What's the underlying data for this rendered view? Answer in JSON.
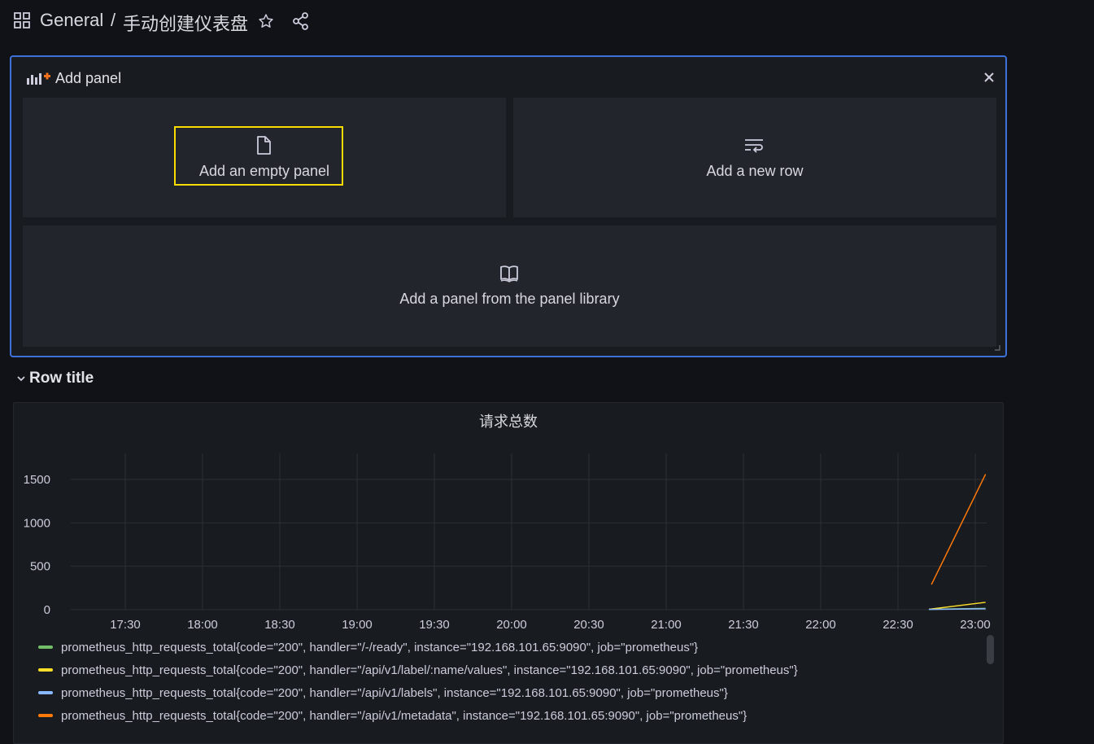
{
  "header": {
    "folder": "General",
    "separator": "/",
    "dashboard_title": "手动创建仪表盘",
    "icons": [
      "apps-grid-icon",
      "star-icon",
      "share-icon"
    ]
  },
  "add_panel": {
    "title": "Add panel",
    "options": [
      {
        "label": "Add an empty panel",
        "icon": "file-icon",
        "highlighted": true
      },
      {
        "label": "Add a new row",
        "icon": "row-wrap-icon"
      },
      {
        "label": "Add a panel from the panel library",
        "icon": "book-icon"
      }
    ],
    "accent": "#3d71d9",
    "highlight_color": "#fadc00"
  },
  "row": {
    "title": "Row title"
  },
  "graph": {
    "title": "请求总数"
  },
  "chart_data": {
    "type": "line",
    "title": "请求总数",
    "xlabel": "",
    "ylabel": "",
    "x_ticks": [
      "17:30",
      "18:00",
      "18:30",
      "19:00",
      "19:30",
      "20:00",
      "20:30",
      "21:00",
      "21:30",
      "22:00",
      "22:30",
      "23:00"
    ],
    "y_ticks": [
      0,
      500,
      1000,
      1500
    ],
    "ylim": [
      0,
      1800
    ],
    "grid": true,
    "legend_position": "bottom",
    "series": [
      {
        "name": "prometheus_http_requests_total{code=\"200\", handler=\"/-/ready\", instance=\"192.168.101.65:9090\", job=\"prometheus\"}",
        "color": "#73bf69",
        "x": [
          "22:42",
          "23:04"
        ],
        "y": [
          5,
          15
        ]
      },
      {
        "name": "prometheus_http_requests_total{code=\"200\", handler=\"/api/v1/label/:name/values\", instance=\"192.168.101.65:9090\", job=\"prometheus\"}",
        "color": "#fade2a",
        "x": [
          "22:42",
          "23:04"
        ],
        "y": [
          5,
          85
        ]
      },
      {
        "name": "prometheus_http_requests_total{code=\"200\", handler=\"/api/v1/labels\", instance=\"192.168.101.65:9090\", job=\"prometheus\"}",
        "color": "#8ab8ff",
        "x": [
          "22:42",
          "23:04"
        ],
        "y": [
          3,
          10
        ]
      },
      {
        "name": "prometheus_http_requests_total{code=\"200\", handler=\"/api/v1/metadata\", instance=\"192.168.101.65:9090\", job=\"prometheus\"}",
        "color": "#ff780a",
        "x": [
          "22:43",
          "23:04"
        ],
        "y": [
          290,
          1560
        ]
      }
    ]
  }
}
